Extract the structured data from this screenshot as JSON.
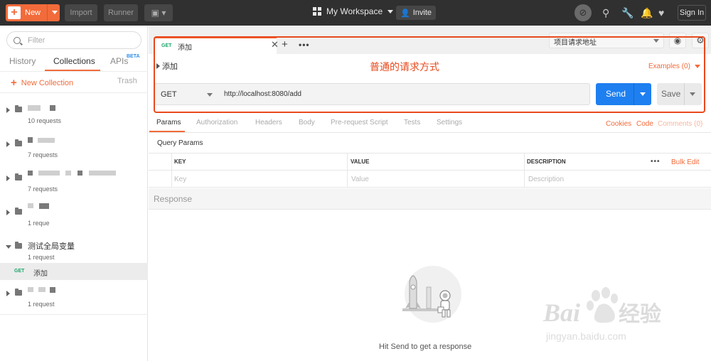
{
  "topbar": {
    "new_label": "New",
    "import_label": "Import",
    "runner_label": "Runner",
    "workspace_label": "My Workspace",
    "invite_label": "Invite",
    "signin_label": "Sign In"
  },
  "sidebar": {
    "filter_placeholder": "Filter",
    "tabs": [
      "History",
      "Collections",
      "APIs"
    ],
    "beta": "BETA",
    "new_collection": "New Collection",
    "trash": "Trash",
    "collections": [
      {
        "name": "",
        "count": "10 requests"
      },
      {
        "name": "",
        "count": "7 requests"
      },
      {
        "name": "",
        "count": "7 requests"
      },
      {
        "name": "",
        "count": "1 reque"
      },
      {
        "name": "测试全局变量",
        "count": "1 request"
      },
      {
        "name": "",
        "count": "1 request"
      }
    ],
    "request": {
      "method": "GET",
      "name": "添加"
    }
  },
  "request_tab": {
    "method": "GET",
    "name": "添加"
  },
  "environment": "项目请求地址",
  "request": {
    "title": "添加",
    "annotation": "普通的请求方式",
    "examples": "Examples (0)",
    "method": "GET",
    "url": "http://localhost:8080/add",
    "send_label": "Send",
    "save_label": "Save"
  },
  "subtabs": [
    "Params",
    "Authorization",
    "Headers",
    "Body",
    "Pre-request Script",
    "Tests",
    "Settings"
  ],
  "right_links": [
    "Cookies",
    "Code",
    "Comments (0)"
  ],
  "query_params": {
    "title": "Query Params",
    "headers": [
      "KEY",
      "VALUE",
      "DESCRIPTION"
    ],
    "placeholders": [
      "Key",
      "Value",
      "Description"
    ],
    "bulk_edit": "Bulk Edit"
  },
  "response": {
    "title": "Response",
    "empty_text": "Hit Send to get a response"
  },
  "colors": {
    "accent": "#f26b3a",
    "send_blue": "#1e7ff0",
    "get_green": "#1aa56a",
    "annotation_red": "#e8491d"
  }
}
